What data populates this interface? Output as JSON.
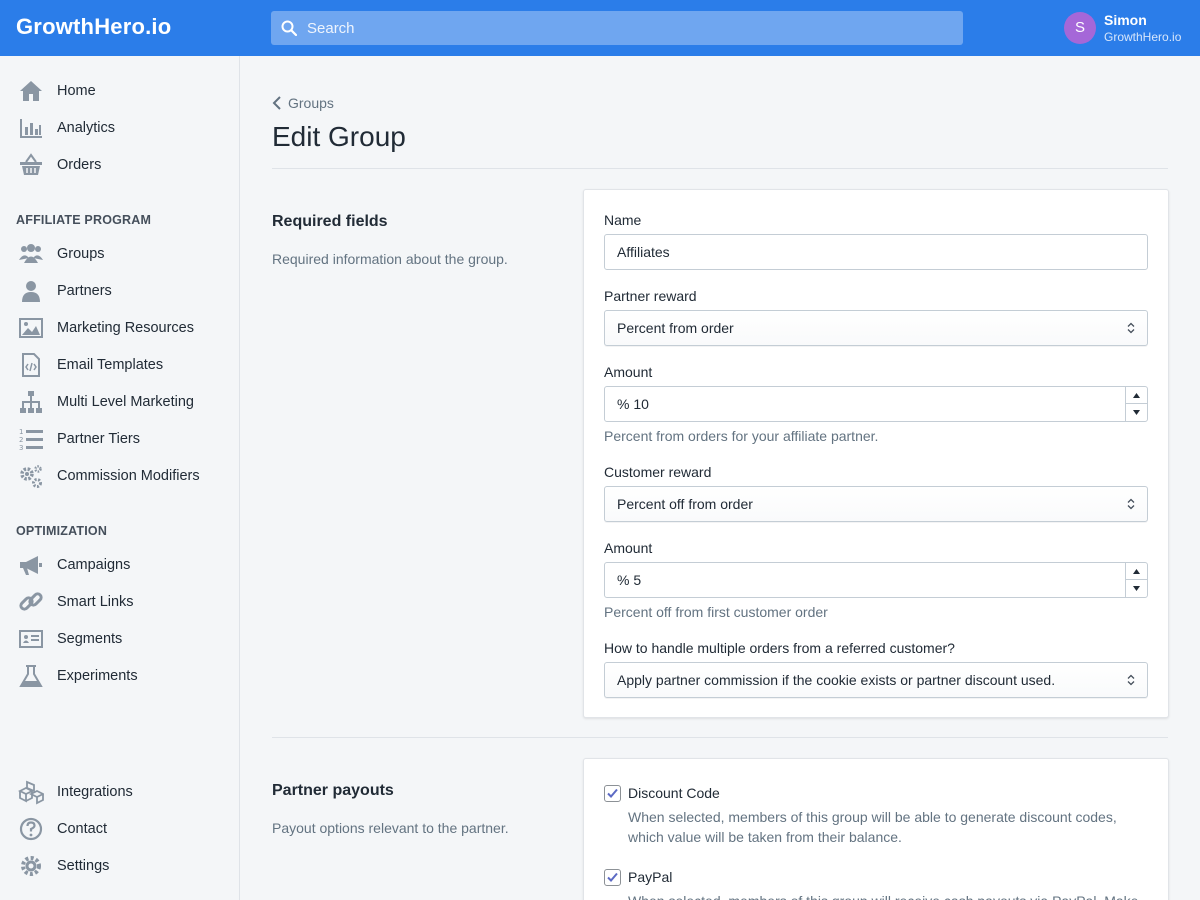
{
  "app": {
    "logo": "GrowthHero.io"
  },
  "search": {
    "placeholder": "Search"
  },
  "user": {
    "initial": "S",
    "name": "Simon",
    "org": "GrowthHero.io"
  },
  "colors": {
    "topbar": "#2b7de9",
    "avatar": "#a567d8",
    "check": "#5c6ac4"
  },
  "sidebar": {
    "top_items": [
      {
        "label": "Home",
        "icon": "home-icon"
      },
      {
        "label": "Analytics",
        "icon": "bar-chart-icon"
      },
      {
        "label": "Orders",
        "icon": "basket-icon"
      }
    ],
    "affiliate_title": "AFFILIATE PROGRAM",
    "affiliate_items": [
      {
        "label": "Groups",
        "icon": "users-group-icon"
      },
      {
        "label": "Partners",
        "icon": "person-icon"
      },
      {
        "label": "Marketing Resources",
        "icon": "image-icon"
      },
      {
        "label": "Email Templates",
        "icon": "code-file-icon"
      },
      {
        "label": "Multi Level Marketing",
        "icon": "sitemap-icon"
      },
      {
        "label": "Partner Tiers",
        "icon": "numbered-list-icon"
      },
      {
        "label": "Commission Modifiers",
        "icon": "gears-icon"
      }
    ],
    "optimization_title": "OPTIMIZATION",
    "optimization_items": [
      {
        "label": "Campaigns",
        "icon": "megaphone-icon"
      },
      {
        "label": "Smart Links",
        "icon": "link-icon"
      },
      {
        "label": "Segments",
        "icon": "id-card-icon"
      },
      {
        "label": "Experiments",
        "icon": "flask-icon"
      }
    ],
    "bottom_items": [
      {
        "label": "Integrations",
        "icon": "cubes-icon"
      },
      {
        "label": "Contact",
        "icon": "question-icon"
      },
      {
        "label": "Settings",
        "icon": "gear-icon"
      }
    ]
  },
  "breadcrumb": {
    "label": "Groups"
  },
  "page": {
    "title": "Edit Group"
  },
  "required": {
    "heading": "Required fields",
    "description": "Required information about the group.",
    "name_label": "Name",
    "name_value": "Affiliates",
    "partner_reward_label": "Partner reward",
    "partner_reward_value": "Percent from order",
    "amount1_label": "Amount",
    "amount1_value": "% 10",
    "amount1_help": "Percent from orders for your affiliate partner.",
    "customer_reward_label": "Customer reward",
    "customer_reward_value": "Percent off from order",
    "amount2_label": "Amount",
    "amount2_value": "% 5",
    "amount2_help": "Percent off from first customer order",
    "multi_label": "How to handle multiple orders from a referred customer?",
    "multi_value": "Apply partner commission if the cookie exists or partner discount used."
  },
  "payouts": {
    "heading": "Partner payouts",
    "description": "Payout options relevant to the partner.",
    "discount_label": "Discount Code",
    "discount_help": "When selected, members of this group will be able to generate discount codes, which value will be taken from their balance.",
    "paypal_label": "PayPal",
    "paypal_help": "When selected, members of this group will receive cash payouts via PayPal. Make"
  }
}
